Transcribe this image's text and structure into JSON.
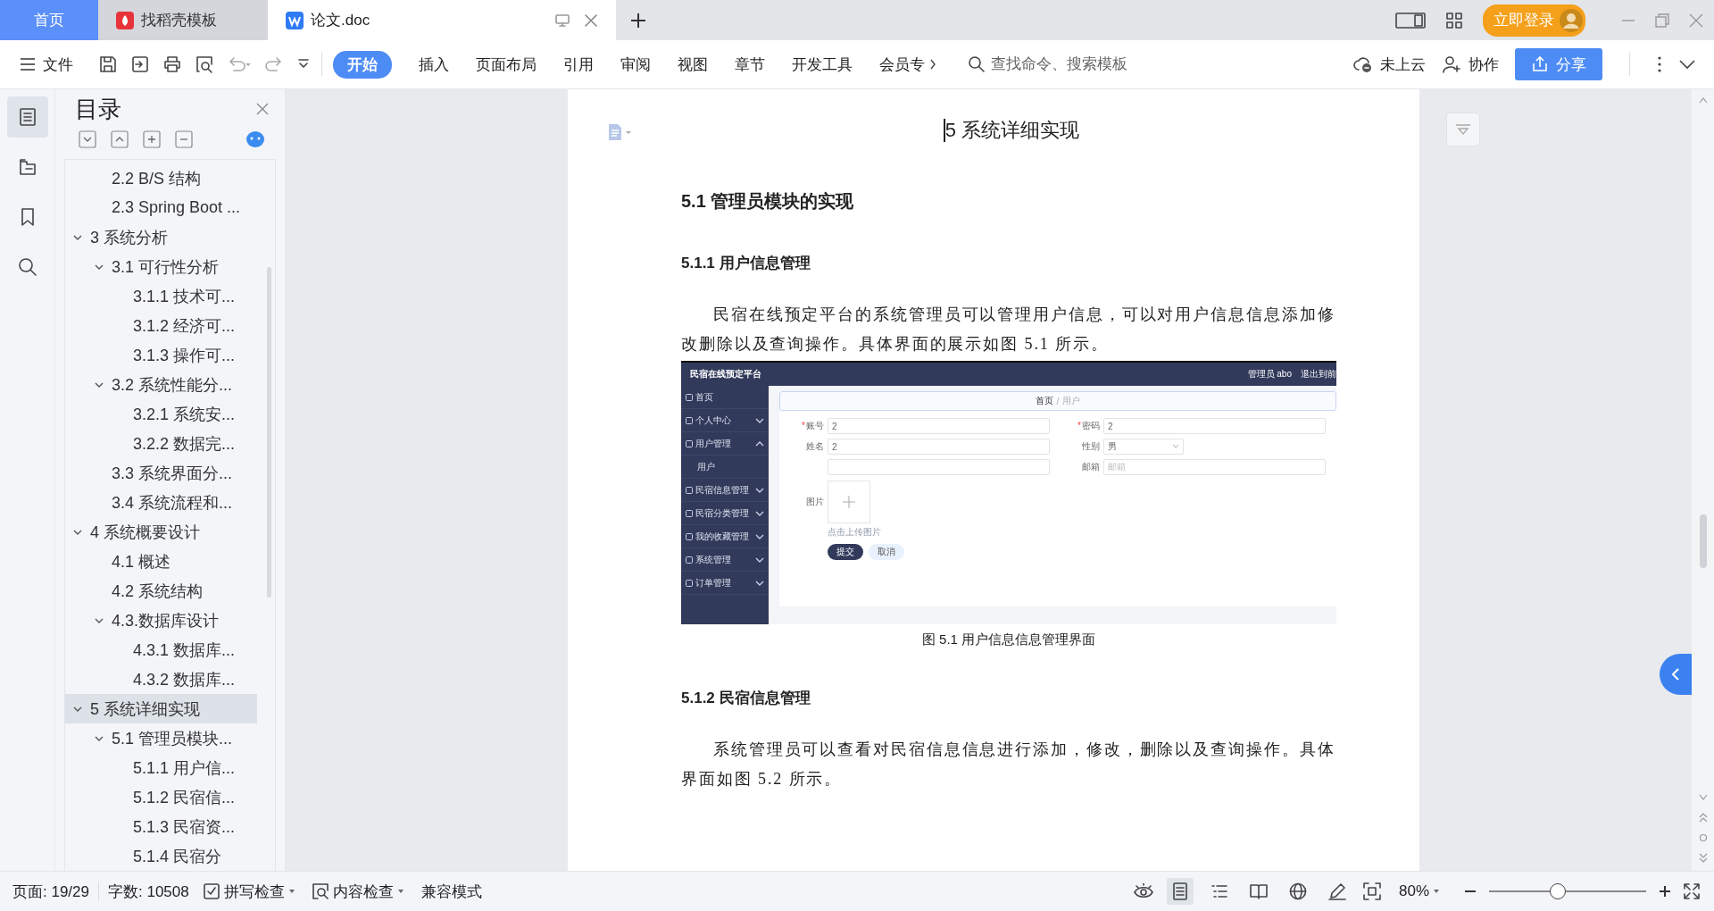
{
  "tabs": [
    {
      "label": "首页",
      "kind": "home",
      "selected": false
    },
    {
      "label": "找稻壳模板",
      "kind": "docer",
      "selected": false
    },
    {
      "label": "论文.doc",
      "kind": "doc",
      "selected": true
    }
  ],
  "account": {
    "login": "立即登录"
  },
  "toolbar": {
    "file": "文件",
    "ribbon_tabs": [
      {
        "label": "开始",
        "selected": true
      },
      {
        "label": "插入",
        "selected": false
      },
      {
        "label": "页面布局",
        "selected": false
      },
      {
        "label": "引用",
        "selected": false
      },
      {
        "label": "审阅",
        "selected": false
      },
      {
        "label": "视图",
        "selected": false
      },
      {
        "label": "章节",
        "selected": false
      },
      {
        "label": "开发工具",
        "selected": false
      },
      {
        "label": "会员专",
        "selected": false
      }
    ],
    "search": {
      "placeholder": "查找命令、搜索模板"
    },
    "cloud": "未上云",
    "collab": "协作",
    "share": "分享"
  },
  "rail": [
    {
      "kind": "toc",
      "selected": true
    },
    {
      "kind": "outline",
      "selected": false
    },
    {
      "kind": "bookmark",
      "selected": false
    },
    {
      "kind": "search",
      "selected": false
    }
  ],
  "toc": {
    "title": "目录",
    "items": [
      {
        "children": [
          {
            "label": "2.2 B/S 结构",
            "selected": false
          },
          {
            "label": "2.3 Spring Boot ...",
            "selected": false
          }
        ]
      },
      {
        "label": "3 系统分析",
        "selected": false,
        "expanded": true,
        "children": [
          {
            "label": "3.1 可行性分析",
            "selected": false,
            "expanded": true,
            "children": [
              {
                "label": "3.1.1 技术可...",
                "selected": false
              },
              {
                "label": "3.1.2 经济可...",
                "selected": false
              },
              {
                "label": "3.1.3 操作可...",
                "selected": false
              }
            ]
          },
          {
            "label": "3.2 系统性能分...",
            "selected": false,
            "expanded": true,
            "children": [
              {
                "label": "3.2.1  系统安...",
                "selected": false
              },
              {
                "label": "3.2.2  数据完...",
                "selected": false
              }
            ]
          },
          {
            "label": "3.3 系统界面分...",
            "selected": false
          },
          {
            "label": "3.4 系统流程和...",
            "selected": false
          }
        ]
      },
      {
        "label": "4 系统概要设计",
        "selected": false,
        "expanded": true,
        "children": [
          {
            "label": "4.1 概述",
            "selected": false
          },
          {
            "label": "4.2 系统结构",
            "selected": false
          },
          {
            "label": "4.3.数据库设计",
            "selected": false,
            "expanded": true,
            "children": [
              {
                "label": "4.3.1 数据库...",
                "selected": false
              },
              {
                "label": "4.3.2 数据库...",
                "selected": false
              }
            ]
          }
        ]
      },
      {
        "label": "5 系统详细实现",
        "selected": true,
        "expanded": true,
        "children": [
          {
            "label": "5.1  管理员模块...",
            "selected": false,
            "expanded": true,
            "children": [
              {
                "label": "5.1.1  用户信...",
                "selected": false
              },
              {
                "label": "5.1.2  民宿信...",
                "selected": false
              },
              {
                "label": "5.1.3  民宿资...",
                "selected": false
              },
              {
                "label": "5.1.4  民宿分",
                "selected": false
              }
            ]
          }
        ]
      }
    ]
  },
  "document": {
    "blocks": [
      {
        "kind": "h1",
        "text": "5 系统详细实现"
      },
      {
        "kind": "h2",
        "text": "5.1  管理员模块的实现"
      },
      {
        "kind": "h3",
        "text": "5.1.1  用户信息管理"
      },
      {
        "kind": "para",
        "text": "民宿在线预定平台的系统管理员可以管理用户信息，可以对用户信息信息添加修改删除以及查询操作。具体界面的展示如图 5.1 所示。"
      },
      {
        "kind": "figure",
        "app": {
          "brand": "民宿在线预定平台",
          "user": "管理员 abo",
          "logout": "退出到前",
          "menu": [
            {
              "label": "首页"
            },
            {
              "label": "个人中心",
              "expanded": false
            },
            {
              "label": "用户管理",
              "expanded": true,
              "children": [
                {
                  "label": "用户"
                }
              ]
            },
            {
              "label": "民宿信息管理",
              "expanded": false
            },
            {
              "label": "民宿分类管理",
              "expanded": false
            },
            {
              "label": "我的收藏管理",
              "expanded": false
            },
            {
              "label": "系统管理",
              "expanded": false
            },
            {
              "label": "订单管理",
              "expanded": false
            }
          ],
          "breadcrumb": {
            "items": [
              "首页",
              "用户"
            ],
            "separator": "/"
          },
          "required_mark": "*",
          "fields": [
            {
              "kind": "input",
              "label": "账号",
              "value": "2",
              "required": true
            },
            {
              "kind": "input",
              "label": "密码",
              "value": "2",
              "required": true
            },
            {
              "kind": "input",
              "label": "姓名",
              "value": "2",
              "required": false
            },
            {
              "kind": "select",
              "label": "性别",
              "value": "男",
              "required": false
            },
            {
              "kind": "input",
              "required": false
            },
            {
              "kind": "input",
              "label": "邮箱",
              "placeholder": "邮箱",
              "required": false
            }
          ],
          "upload": {
            "label": "图片",
            "hint": "点击上传图片"
          },
          "buttons": [
            {
              "label": "提交",
              "kind": "primary"
            },
            {
              "label": "取消",
              "kind": "plain"
            }
          ]
        }
      },
      {
        "kind": "caption",
        "text": "图 5.1  用户信息信息管理界面"
      },
      {
        "kind": "h3",
        "text": "5.1.2  民宿信息管理"
      },
      {
        "kind": "para",
        "text": "系统管理员可以查看对民宿信息信息进行添加，修改，删除以及查询操作。具体界面如图 5.2 所示。"
      }
    ]
  },
  "status_bar": {
    "page": "页面: 19/29",
    "words": "字数: 10508",
    "spell": "拼写检查",
    "content": "内容检查",
    "mode": "兼容模式",
    "view_modes": [
      {
        "kind": "page",
        "selected": true
      },
      {
        "kind": "outline",
        "selected": false
      },
      {
        "kind": "read",
        "selected": false
      },
      {
        "kind": "web",
        "selected": false
      },
      {
        "kind": "write",
        "selected": false
      }
    ],
    "zoom": "80%",
    "zoom_slider": {
      "level": 0.44
    }
  }
}
